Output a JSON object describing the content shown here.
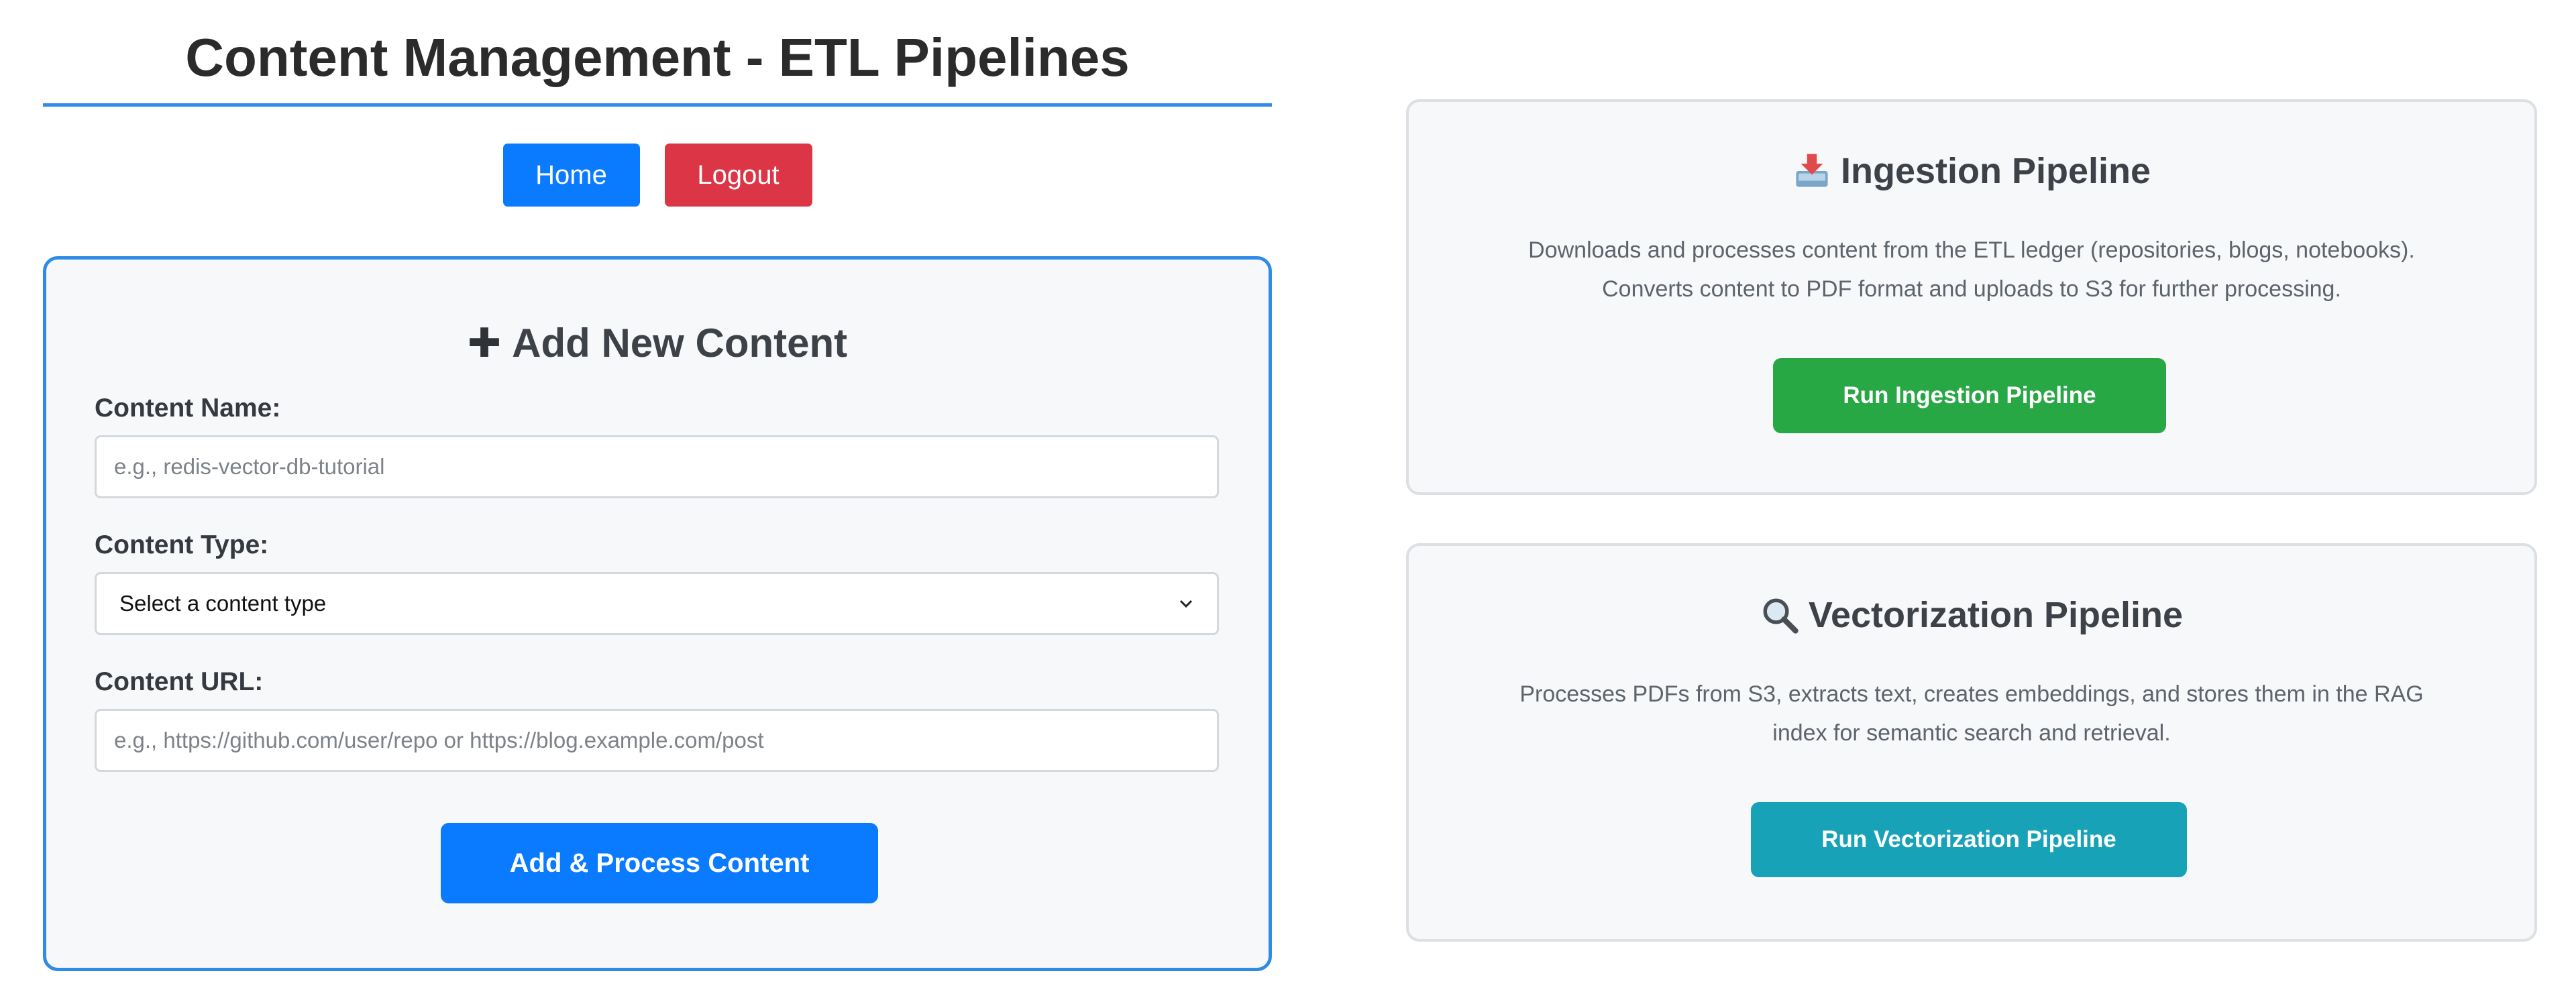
{
  "header": {
    "title": "Content Management - ETL Pipelines"
  },
  "nav": {
    "home_label": "Home",
    "logout_label": "Logout"
  },
  "add_content": {
    "heading": "Add New Content",
    "heading_icon": "plus-icon",
    "name_label": "Content Name:",
    "name_placeholder": "e.g., redis-vector-db-tutorial",
    "name_value": "",
    "type_label": "Content Type:",
    "type_selected": "Select a content type",
    "url_label": "Content URL:",
    "url_placeholder": "e.g., https://github.com/user/repo or https://blog.example.com/post",
    "url_value": "",
    "submit_label": "Add & Process Content"
  },
  "pipelines": [
    {
      "icon": "inbox-tray-icon",
      "title": "Ingestion Pipeline",
      "description_lines": [
        "Downloads and processes content from the ETL ledger (repositories, blogs, notebooks).",
        "Converts content to PDF format and uploads to S3 for further processing."
      ],
      "button_label": "Run Ingestion Pipeline",
      "button_color": "#28a745"
    },
    {
      "icon": "magnifier-icon",
      "title": "Vectorization Pipeline",
      "description_lines": [
        "Processes PDFs from S3, extracts text, creates embeddings, and stores them in the RAG",
        "index for semantic search and retrieval."
      ],
      "button_label": "Run Vectorization Pipeline",
      "button_color": "#17a2b8"
    }
  ],
  "colors": {
    "primary": "#0a7bff",
    "danger": "#dc3545",
    "accent_border": "#2f8ae8"
  }
}
